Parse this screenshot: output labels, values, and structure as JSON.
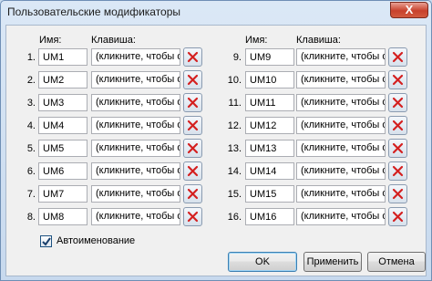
{
  "window": {
    "title": "Пользовательские модификаторы",
    "close_label": "X"
  },
  "headers": {
    "name": "Имя:",
    "key": "Клавиша:"
  },
  "rows": [
    {
      "num": "1.",
      "name": "UM1",
      "key": "(кликните, чтобы оп"
    },
    {
      "num": "2.",
      "name": "UM2",
      "key": "(кликните, чтобы оп"
    },
    {
      "num": "3.",
      "name": "UM3",
      "key": "(кликните, чтобы оп"
    },
    {
      "num": "4.",
      "name": "UM4",
      "key": "(кликните, чтобы оп"
    },
    {
      "num": "5.",
      "name": "UM5",
      "key": "(кликните, чтобы оп"
    },
    {
      "num": "6.",
      "name": "UM6",
      "key": "(кликните, чтобы оп"
    },
    {
      "num": "7.",
      "name": "UM7",
      "key": "(кликните, чтобы оп"
    },
    {
      "num": "8.",
      "name": "UM8",
      "key": "(кликните, чтобы оп"
    },
    {
      "num": "9.",
      "name": "UM9",
      "key": "(кликните, чтобы оп"
    },
    {
      "num": "10.",
      "name": "UM10",
      "key": "(кликните, чтобы оп"
    },
    {
      "num": "11.",
      "name": "UM11",
      "key": "(кликните, чтобы оп"
    },
    {
      "num": "12.",
      "name": "UM12",
      "key": "(кликните, чтобы оп"
    },
    {
      "num": "13.",
      "name": "UM13",
      "key": "(кликните, чтобы оп"
    },
    {
      "num": "14.",
      "name": "UM14",
      "key": "(кликните, чтобы оп"
    },
    {
      "num": "15.",
      "name": "UM15",
      "key": "(кликните, чтобы оп"
    },
    {
      "num": "16.",
      "name": "UM16",
      "key": "(кликните, чтобы оп"
    }
  ],
  "auto_naming": {
    "label": "Автоименование",
    "checked": true
  },
  "buttons": {
    "ok": "OK",
    "apply": "Применить",
    "cancel": "Отмена"
  },
  "icons": {
    "clear": "red-x-icon",
    "close": "close-icon",
    "check": "checkmark-icon"
  },
  "colors": {
    "clear_x": "#d42020",
    "close_button": "#c8412c"
  }
}
